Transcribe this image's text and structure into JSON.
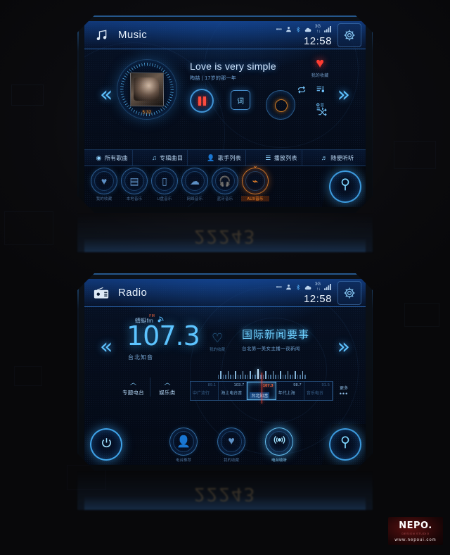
{
  "brand": {
    "logo_text": "NEPO.",
    "logo_sub": "DESIGN STUDIO",
    "logo_url": "www.nepoui.com"
  },
  "reflection": {
    "text": "22243"
  },
  "music_screen": {
    "header": {
      "app_icon": "music-note-icon",
      "title": "Music",
      "clock": "12:58",
      "status_icons": [
        "ellipsis-icon",
        "user-icon",
        "bluetooth-icon",
        "cloud-icon",
        "3g-icon",
        "signal-bars-icon"
      ],
      "settings_icon": "gear-icon"
    },
    "nav": {
      "prev": "«",
      "next": "»"
    },
    "player": {
      "album_art": "album-cover",
      "elapsed": "5:32",
      "track_title": "Love is very simple",
      "track_subtitle": "陶喆 | 17岁的那一年",
      "play_state_icon": "pause-icon",
      "lyrics_icon": "词",
      "repeat_icon": "repeat-icon",
      "shuffle_icon": "shuffle-icon",
      "dial_icon": "volume-dial"
    },
    "side_actions": {
      "favorite_icon": "heart-icon",
      "favorite_label": "我的收藏",
      "playlist_icon": "playlist-icon",
      "sort_icon": "sort-icon"
    },
    "tabs": [
      {
        "icon": "disc-icon",
        "label": "所有歌曲"
      },
      {
        "icon": "note-icon",
        "label": "专辑曲目"
      },
      {
        "icon": "person-icon",
        "label": "歌手列表"
      },
      {
        "icon": "list-icon",
        "label": "播放列表"
      },
      {
        "icon": "shuffle-note-icon",
        "label": "随便听听"
      }
    ],
    "dock": [
      {
        "icon": "heart-icon",
        "label": "我的收藏",
        "active": false
      },
      {
        "icon": "book-icon",
        "label": "本地音乐",
        "active": false
      },
      {
        "icon": "usb-icon",
        "label": "U盘音乐",
        "active": false
      },
      {
        "icon": "cloud-icon",
        "label": "网络音乐",
        "active": false
      },
      {
        "icon": "headphone-icon",
        "label": "蓝牙音乐",
        "active": false
      },
      {
        "icon": "aux-icon",
        "label": "AUX音乐",
        "active": true
      }
    ],
    "corner_button_icon": "search-pin-icon"
  },
  "radio_screen": {
    "header": {
      "app_icon": "radio-icon",
      "title": "Radio",
      "clock": "12:58",
      "status_icons": [
        "ellipsis-icon",
        "user-icon",
        "bluetooth-icon",
        "cloud-icon",
        "3g-icon",
        "signal-bars-icon"
      ],
      "settings_icon": "gear-icon"
    },
    "nav": {
      "prev": "«",
      "next": "»"
    },
    "now": {
      "source_name": "蜻蜓fm",
      "wave_icon": "broadcast-icon",
      "frequency": "107.3",
      "station_name": "台北知音",
      "favorite_icon": "heart-icon",
      "favorite_label": "我的收藏",
      "program_title": "国际新闻要事",
      "program_subtitle": "台北第一美女主播一夜新闻"
    },
    "categories": [
      {
        "chevron": "chevron-up-icon",
        "label": "专题电台"
      },
      {
        "chevron": "chevron-up-icon",
        "label": "娱乐类"
      }
    ],
    "presets": [
      {
        "freq": "89.1",
        "name": "中广流行",
        "selected": false,
        "dim": true
      },
      {
        "freq": "103.7",
        "name": "海上电台音",
        "selected": false,
        "dim": false
      },
      {
        "freq": "107.3",
        "name": "台北知音",
        "selected": true,
        "dim": false
      },
      {
        "freq": "98.7",
        "name": "年代上海",
        "selected": false,
        "dim": false
      },
      {
        "freq": "91.5",
        "name": "音乐电台",
        "selected": false,
        "dim": true
      }
    ],
    "more": {
      "label": "更多",
      "dots": "•••"
    },
    "dock": {
      "power_icon": "power-icon",
      "buttons": [
        {
          "icon": "person-icon",
          "label": "电台推荐",
          "active": false
        },
        {
          "icon": "heart-icon",
          "label": "我的收藏",
          "active": false
        },
        {
          "icon": "broadcast-icon",
          "label": "电台收听",
          "active": true
        }
      ],
      "corner_button_icon": "search-pin-icon"
    }
  }
}
